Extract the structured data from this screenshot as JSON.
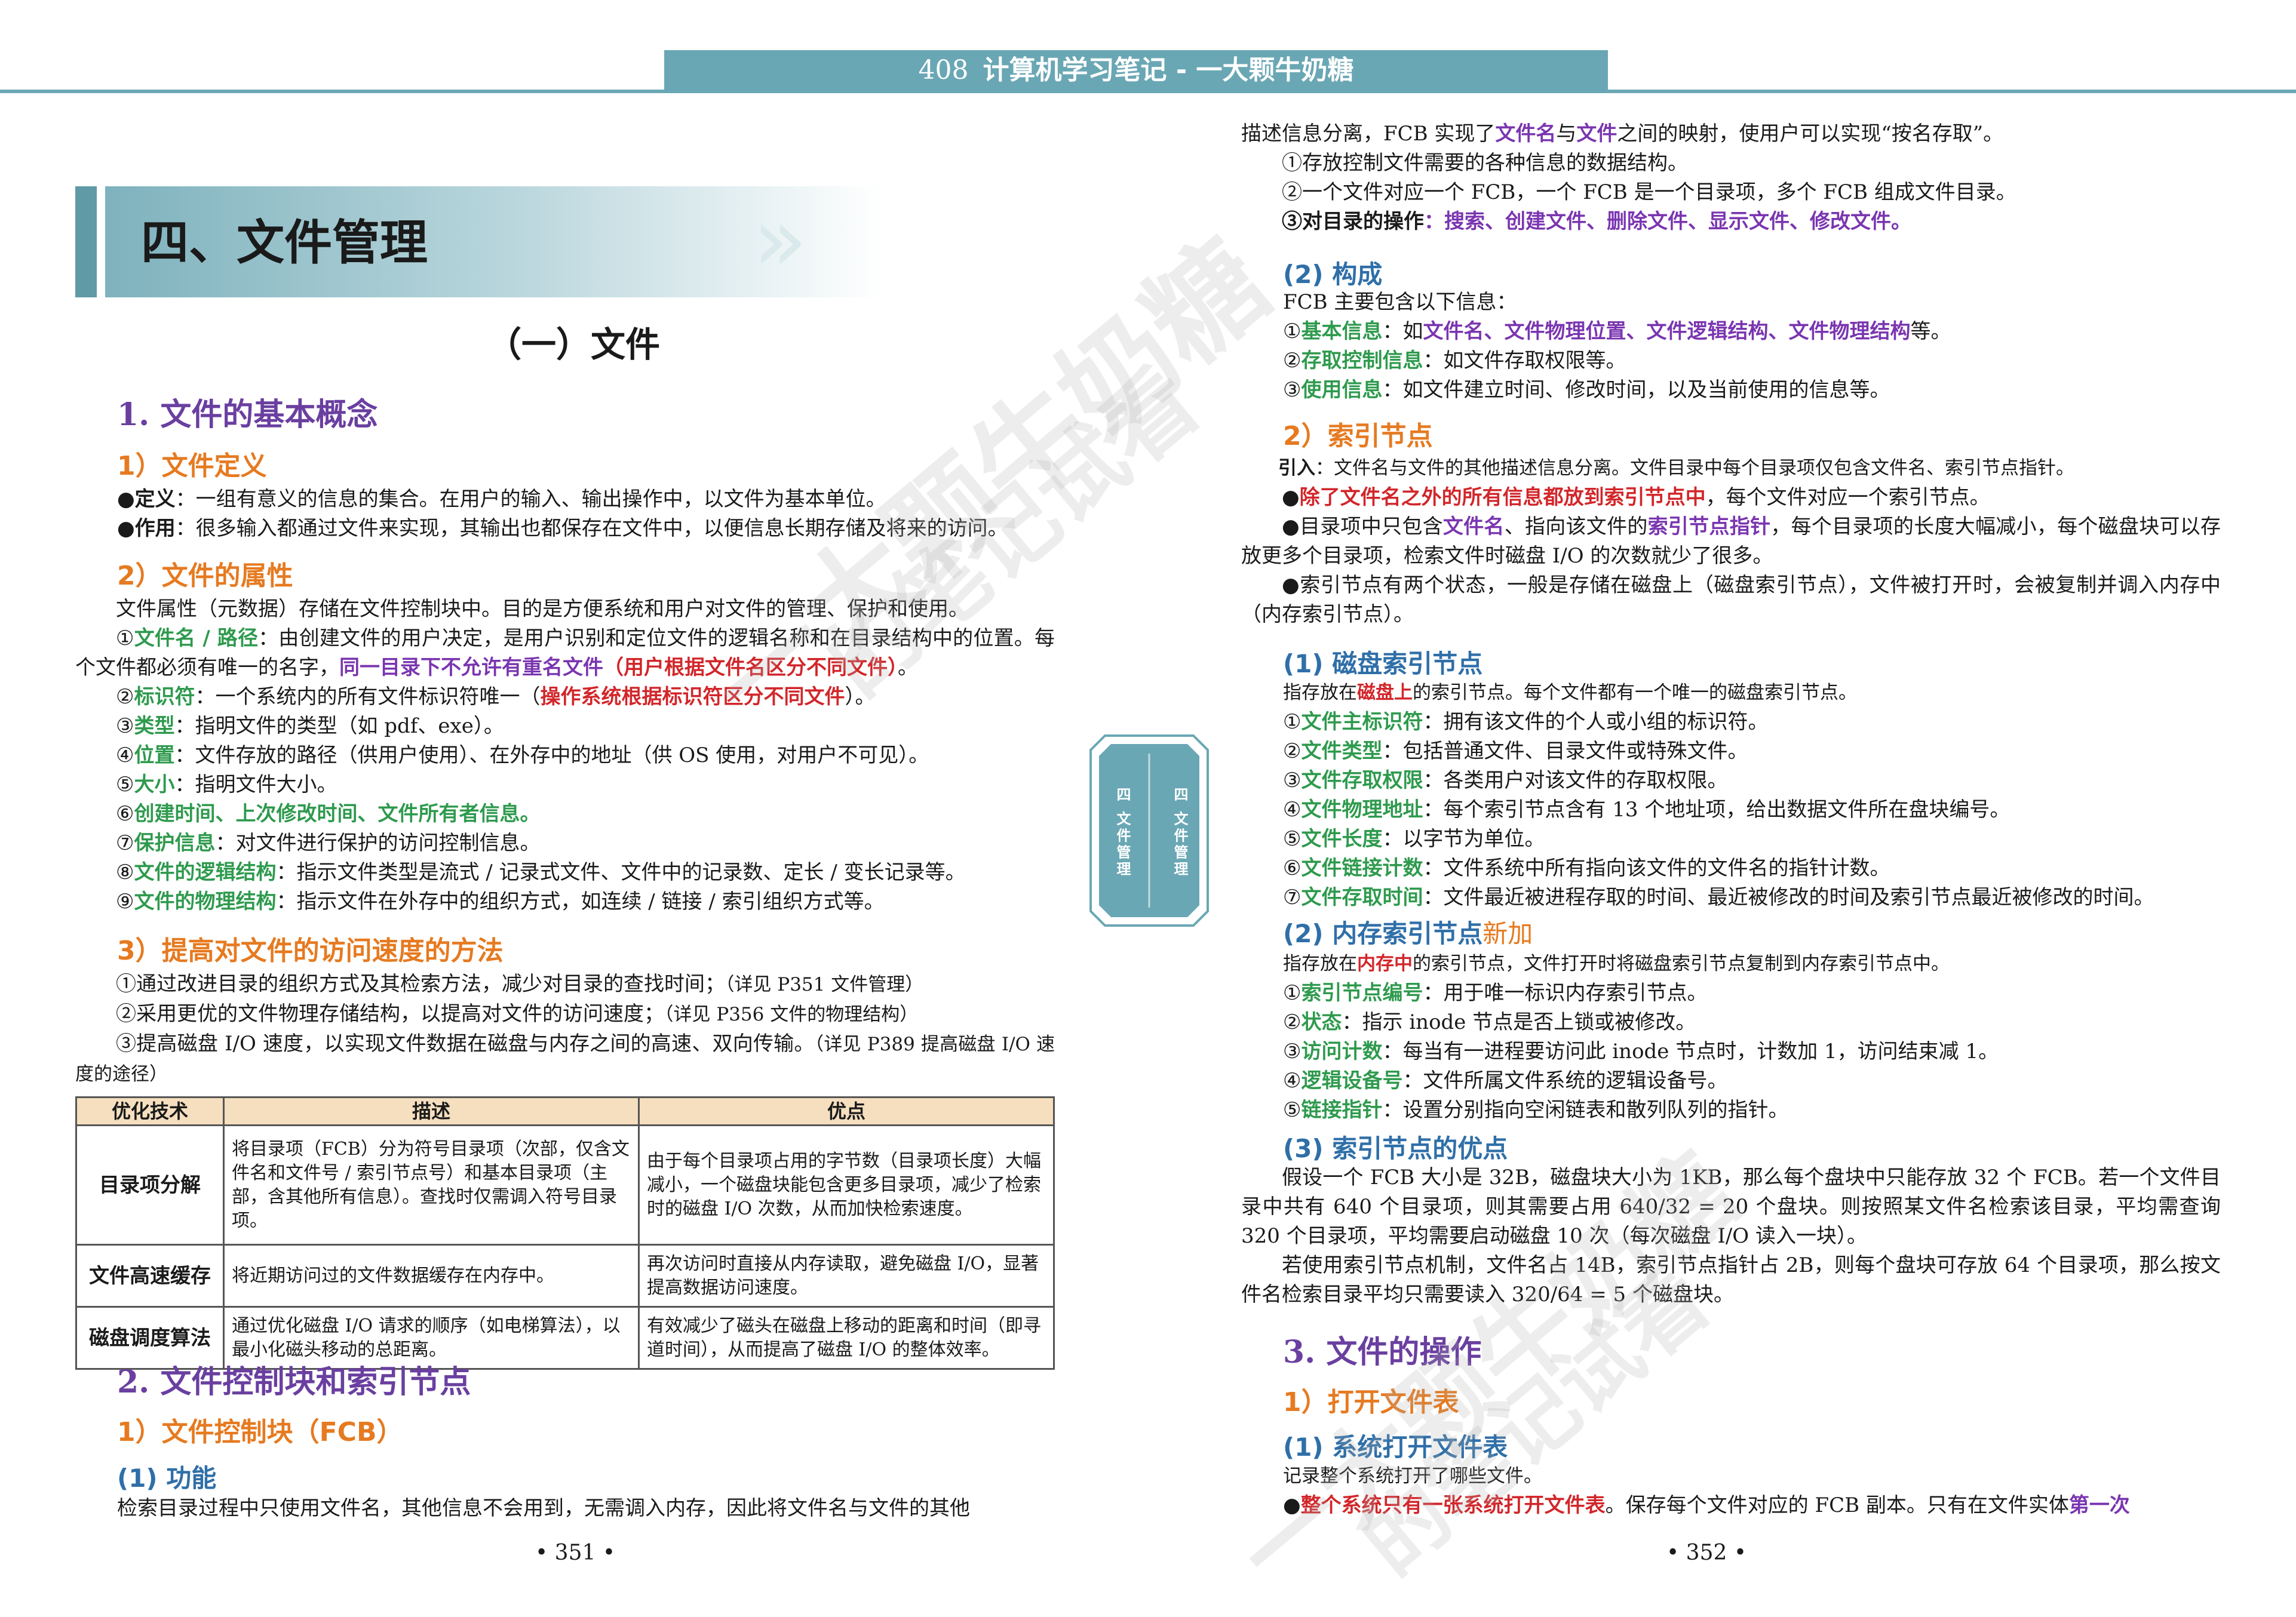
{
  "header": {
    "page_num": "408",
    "title": "计算机学习笔记 - 一大颗牛奶糖"
  },
  "left": {
    "chapter_title": "四、文件管理",
    "section_title": "（一）文件",
    "h1_basic": "1. 文件的基本概念",
    "h2_def": "1）文件定义",
    "def_items": [
      [
        "定义",
        "：一组有意义的信息的集合。在用户的输入、输出操作中，以文件为基本单位。"
      ],
      [
        "作用",
        "：很多输入都通过文件来实现，其输出也都保存在文件中，以便信息长期存储及将来的访问。"
      ]
    ],
    "h2_attr": "2）文件的属性",
    "attr_intro": "文件属性（元数据）存储在文件控制块中。目的是方便系统和用户对文件的管理、保护和使用。",
    "attr1": {
      "n": "①",
      "k": "文件名 / 路径",
      "t": "：由创建文件的用户决定，是用户识别和定位文件的逻辑名称和在目录结构中的位置。每个文件都必须有唯一的名字，",
      "p": "同一目录下不允许有重名文件",
      "r": "（用户根据文件名区分不同文件）",
      "e": "。"
    },
    "attr2": {
      "n": "②",
      "k": "标识符",
      "t": "：一个系统内的所有文件标识符唯一（",
      "r": "操作系统根据标识符区分不同文件",
      "e": "）。"
    },
    "attr3": {
      "n": "③",
      "k": "类型",
      "t": "：指明文件的类型（如 pdf、exe）。"
    },
    "attr4": {
      "n": "④",
      "k": "位置",
      "t": "：文件存放的路径（供用户使用）、在外存中的地址（供 OS 使用，对用户不可见）。"
    },
    "attr5": {
      "n": "⑤",
      "k": "大小",
      "t": "：指明文件大小。"
    },
    "attr6": {
      "n": "⑥",
      "k": "创建时间、上次修改时间、文件所有者信息。"
    },
    "attr7": {
      "n": "⑦",
      "k": "保护信息",
      "t": "：对文件进行保护的访问控制信息。"
    },
    "attr8": {
      "n": "⑧",
      "k": "文件的逻辑结构",
      "t": "：指示文件类型是流式 / 记录式文件、文件中的记录数、定长 / 变长记录等。"
    },
    "attr9": {
      "n": "⑨",
      "k": "文件的物理结构",
      "t": "：指示文件在外存中的组织方式，如连续 / 链接 / 索引组织方式等。"
    },
    "h2_speed": "3）提高对文件的访问速度的方法",
    "speed_items": [
      {
        "t": "①通过改进目录的组织方式及其检索方法，减少对目录的查找时间；",
        "s": "（详见 P351 文件管理）"
      },
      {
        "t": "②采用更优的文件物理存储结构，以提高对文件的访问速度；",
        "s": "（详见 P356 文件的物理结构）"
      },
      {
        "t": "③提高磁盘 I/O 速度，以实现文件数据在磁盘与内存之间的高速、双向传输。",
        "s": "（详见 P389 提高磁盘 I/O 速度的途径）"
      }
    ],
    "table": {
      "headers": [
        "优化技术",
        "描述",
        "优点"
      ],
      "rows": [
        [
          "目录项分解",
          "将目录项（FCB）分为符号目录项（次部，仅含文件名和文件号 / 索引节点号）和基本目录项（主部，含其他所有信息）。查找时仅需调入符号目录项。",
          "由于每个目录项占用的字节数（目录项长度）大幅减小，一个磁盘块能包含更多目录项，减少了检索时的磁盘 I/O 次数，从而加快检索速度。"
        ],
        [
          "文件高速缓存",
          "将近期访问过的文件数据缓存在内存中。",
          "再次访问时直接从内存读取，避免磁盘 I/O，显著提高数据访问速度。"
        ],
        [
          "磁盘调度算法",
          "通过优化磁盘 I/O 请求的顺序（如电梯算法），以最小化磁头移动的总距离。",
          "有效减少了磁头在磁盘上移动的距离和时间（即寻道时间），从而提高了磁盘 I/O 的整体效率。"
        ]
      ]
    },
    "h1_fcb": "2. 文件控制块和索引节点",
    "h2_fcb": "1）文件控制块（FCB）",
    "h3_func": "(1) 功能",
    "func_text": "检索目录过程中只使用文件名，其他信息不会用到，无需调入内存，因此将文件名与文件的其他",
    "page_num": "• 351 •"
  },
  "tabs": {
    "tab1": "四 文件管理",
    "tab2": "四 文件管理"
  },
  "right": {
    "cont_a": "描述信息分离，FCB 实现了",
    "cont_p1": "文件名",
    "cont_b": "与",
    "cont_p2": "文件",
    "cont_c": "之间的映射，使用户可以实现“按名存取”。",
    "fcb_items": [
      "①存放控制文件需要的各种信息的数据结构。",
      "②一个文件对应一个 FCB，一个 FCB 是一个目录项，多个 FCB 组成文件目录。"
    ],
    "fcb_ops_k": "③对目录的操作",
    "fcb_ops_v": "：搜索、创建文件、删除文件、显示文件、修改文件。",
    "h3_comp": "(2) 构成",
    "comp_intro": "FCB 主要包含以下信息：",
    "comp1": {
      "n": "①",
      "k": "基本信息",
      "t": "：如",
      "p": "文件名、文件物理位置、文件逻辑结构、文件物理结构",
      "e": "等。"
    },
    "comp2": {
      "n": "②",
      "k": "存取控制信息",
      "t": "：如文件存取权限等。"
    },
    "comp3": {
      "n": "③",
      "k": "使用信息",
      "t": "：如文件建立时间、修改时间，以及当前使用的信息等。"
    },
    "h2_inode": "2）索引节点",
    "inode_intro_k": "引入",
    "inode_intro_v": "：文件名与文件的其他描述信息分离。文件目录中每个目录项仅包含文件名、索引节点指针。",
    "inode_b1_r": "除了文件名之外的所有信息都放到索引节点中",
    "inode_b1_t": "，每个文件对应一个索引节点。",
    "inode_b2_a": "目录项中只包含",
    "inode_b2_p1": "文件名",
    "inode_b2_b": "、指向该文件的",
    "inode_b2_p2": "索引节点指针",
    "inode_b2_c": "，每个目录项的长度大幅减小，每个磁盘块可以存放更多个目录项，检索文件时磁盘 I/O 的次数就少了很多。",
    "inode_b3": "索引节点有两个状态，一般是存储在磁盘上（磁盘索引节点），文件被打开时，会被复制并调入内存中（内存索引节点）。",
    "h3_disk": "(1) 磁盘索引节点",
    "disk_intro_a": "指存放在",
    "disk_intro_r": "磁盘上",
    "disk_intro_b": "的索引节点。每个文件都有一个唯一的磁盘索引节点。",
    "disk_items": [
      {
        "n": "①",
        "k": "文件主标识符",
        "t": "：拥有该文件的个人或小组的标识符。"
      },
      {
        "n": "②",
        "k": "文件类型",
        "t": "：包括普通文件、目录文件或特殊文件。"
      },
      {
        "n": "③",
        "k": "文件存取权限",
        "t": "：各类用户对该文件的存取权限。"
      },
      {
        "n": "④",
        "k": "文件物理地址",
        "t": "：每个索引节点含有 13 个地址项，给出数据文件所在盘块编号。"
      },
      {
        "n": "⑤",
        "k": "文件长度",
        "t": "：以字节为单位。"
      },
      {
        "n": "⑥",
        "k": "文件链接计数",
        "t": "：文件系统中所有指向该文件的文件名的指针计数。"
      },
      {
        "n": "⑦",
        "k": "文件存取时间",
        "t": "：文件最近被进程存取的时间、最近被修改的时间及索引节点最近被修改的时间。"
      }
    ],
    "h3_mem": "(2) 内存索引节点",
    "h3_mem_new": "新加",
    "mem_intro_a": "指存放在",
    "mem_intro_r": "内存中",
    "mem_intro_b": "的索引节点，文件打开时将磁盘索引节点复制到内存索引节点中。",
    "mem_items": [
      {
        "n": "①",
        "k": "索引节点编号",
        "t": "：用于唯一标识内存索引节点。"
      },
      {
        "n": "②",
        "k": "状态",
        "t": "：指示 inode 节点是否上锁或被修改。"
      },
      {
        "n": "③",
        "k": "访问计数",
        "t": "：每当有一进程要访问此 inode 节点时，计数加 1，访问结束减 1。"
      },
      {
        "n": "④",
        "k": "逻辑设备号",
        "t": "：文件所属文件系统的逻辑设备号。"
      },
      {
        "n": "⑤",
        "k": "链接指针",
        "t": "：设置分别指向空闲链表和散列队列的指针。"
      }
    ],
    "h3_adv": "(3) 索引节点的优点",
    "adv_p1": "假设一个 FCB 大小是 32B，磁盘块大小为 1KB，那么每个盘块中只能存放 32 个 FCB。若一个文件目录中共有 640 个目录项，则其需要占用 640/32 = 20 个盘块。则按照某文件名检索该目录，平均需查询 320 个目录项，平均需要启动磁盘 10 次（每次磁盘 I/O 读入一块）。",
    "adv_p2": "若使用索引节点机制，文件名占 14B，索引节点指针占 2B，则每个盘块可存放 64 个目录项，那么按文件名检索目录平均只需要读入 320/64 = 5 个磁盘块。",
    "h1_ops": "3. 文件的操作",
    "h2_open": "1）打开文件表",
    "h3_sys": "(1) 系统打开文件表",
    "sys_intro": "记录整个系统打开了哪些文件。",
    "sys_b1_r": "整个系统只有一张系统打开文件表",
    "sys_b1_t": "。保存每个文件对应的 FCB 副本。只有在文件实体",
    "sys_b1_p": "第一次",
    "page_num": "• 352 •"
  },
  "watermark": {
    "line1": "一大颗牛奶糖",
    "line2": "的笔记试看"
  },
  "colors": {
    "accent": "#6aa7b4",
    "heading_purple": "#6a3fa0",
    "heading_orange": "#e67a20",
    "heading_blue": "#2f6fa8",
    "keyword_green": "#2e9a4d",
    "keyword_red": "#d2262a"
  }
}
